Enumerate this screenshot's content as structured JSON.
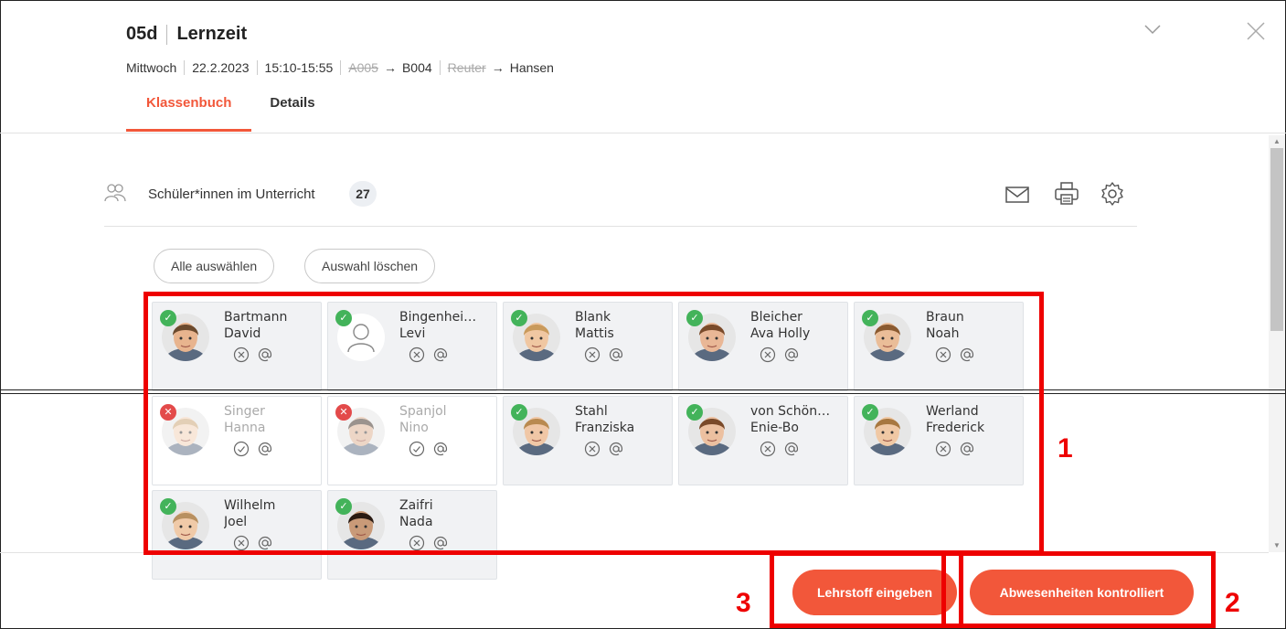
{
  "header": {
    "class": "05d",
    "subject": "Lernzeit",
    "day": "Mittwoch",
    "date": "22.2.2023",
    "time": "15:10-15:55",
    "room_old": "A005",
    "arrow": "→",
    "room_new": "B004",
    "teacher_old": "Reuter",
    "teacher_new": "Hansen",
    "tabs": [
      {
        "label": "Klassenbuch",
        "active": true
      },
      {
        "label": "Details",
        "active": false
      }
    ]
  },
  "students_section": {
    "label": "Schüler*innen im Unterricht",
    "count": "27",
    "icons": [
      "mail-icon",
      "printer-icon",
      "gear-icon"
    ],
    "select_all": "Alle auswählen",
    "clear_selection": "Auswahl löschen"
  },
  "students": [
    {
      "last": "Bartmann",
      "first": "David",
      "present": true,
      "photo": true
    },
    {
      "last": "Bingenhei…",
      "first": "Levi",
      "present": true,
      "photo": false
    },
    {
      "last": "Blank",
      "first": "Mattis",
      "present": true,
      "photo": true
    },
    {
      "last": "Bleicher",
      "first": "Ava Holly",
      "present": true,
      "photo": true
    },
    {
      "last": "Braun",
      "first": "Noah",
      "present": true,
      "photo": true
    },
    {
      "last": "Singer",
      "first": "Hanna",
      "present": false,
      "photo": true
    },
    {
      "last": "Spanjol",
      "first": "Nino",
      "present": false,
      "photo": true
    },
    {
      "last": "Stahl",
      "first": "Franziska",
      "present": true,
      "photo": true
    },
    {
      "last": "von Schön…",
      "first": "Enie-Bo",
      "present": true,
      "photo": true
    },
    {
      "last": "Werland",
      "first": "Frederick",
      "present": true,
      "photo": true
    },
    {
      "last": "Wilhelm",
      "first": "Joel",
      "present": true,
      "photo": true
    },
    {
      "last": "Zaifri",
      "first": "Nada",
      "present": true,
      "photo": true
    }
  ],
  "buttons": {
    "lehrstoff": "Lehrstoff eingeben",
    "abwesenheiten": "Abwesenheiten kontrolliert"
  },
  "annotations": [
    "1",
    "2",
    "3"
  ],
  "colors": {
    "accent": "#f2573a",
    "present": "#43b35a",
    "absent": "#e34a4a",
    "annotation": "#ee0000"
  }
}
